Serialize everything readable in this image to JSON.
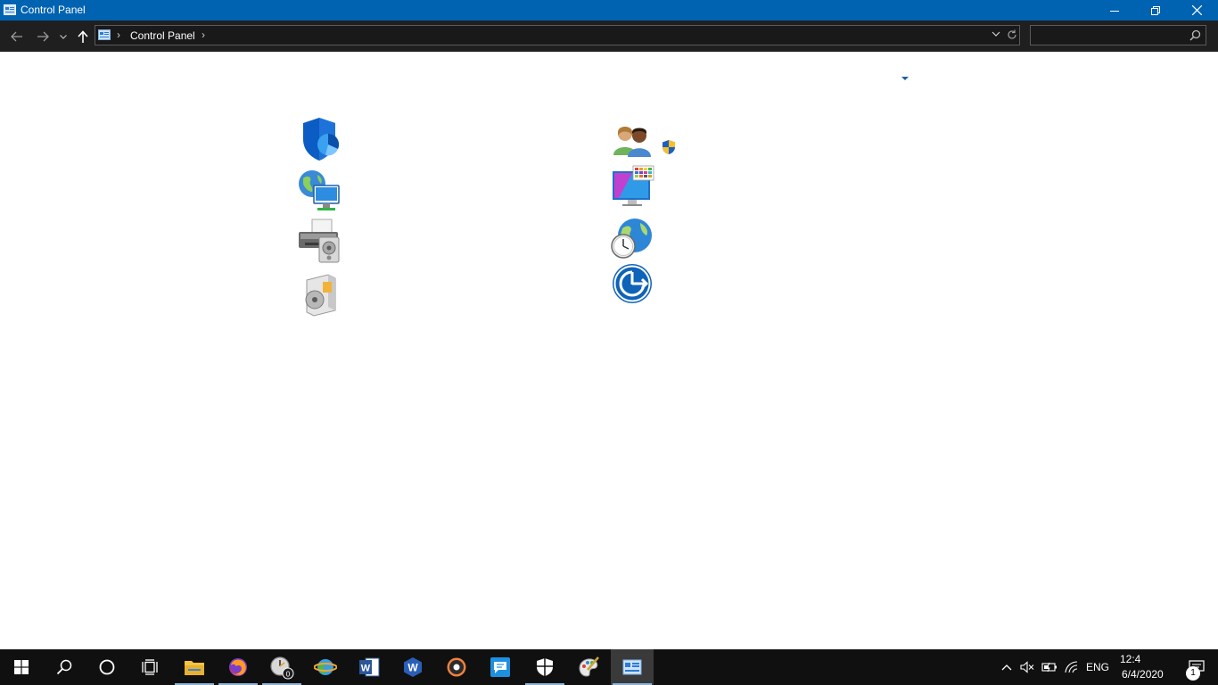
{
  "window": {
    "title": "Control Panel",
    "accent": "#0063b1"
  },
  "address_bar": {
    "breadcrumb": [
      "Control Panel"
    ],
    "search_placeholder": ""
  },
  "content": {
    "categories": [
      {
        "icon": "shield-security-icon"
      },
      {
        "icon": "user-accounts-icon",
        "uac_shield": true
      },
      {
        "icon": "network-globe-monitor-icon"
      },
      {
        "icon": "appearance-monitor-icon"
      },
      {
        "icon": "printer-hardware-icon"
      },
      {
        "icon": "clock-globe-region-icon"
      },
      {
        "icon": "programs-disc-box-icon"
      },
      {
        "icon": "ease-of-access-icon"
      }
    ]
  },
  "taskbar": {
    "apps": [
      "start-icon",
      "search-icon",
      "cortana-icon",
      "task-view-icon",
      "file-explorer-icon",
      "firefox-icon",
      "clock-app-icon",
      "globe-app-icon",
      "word-icon",
      "wps-icon",
      "media-player-icon",
      "messaging-icon",
      "security-icon",
      "paint-icon",
      "control-panel-icon"
    ],
    "tray": {
      "language": "ENG",
      "time": "12:4",
      "date": "6/4/2020",
      "notifications_count": "1"
    }
  }
}
